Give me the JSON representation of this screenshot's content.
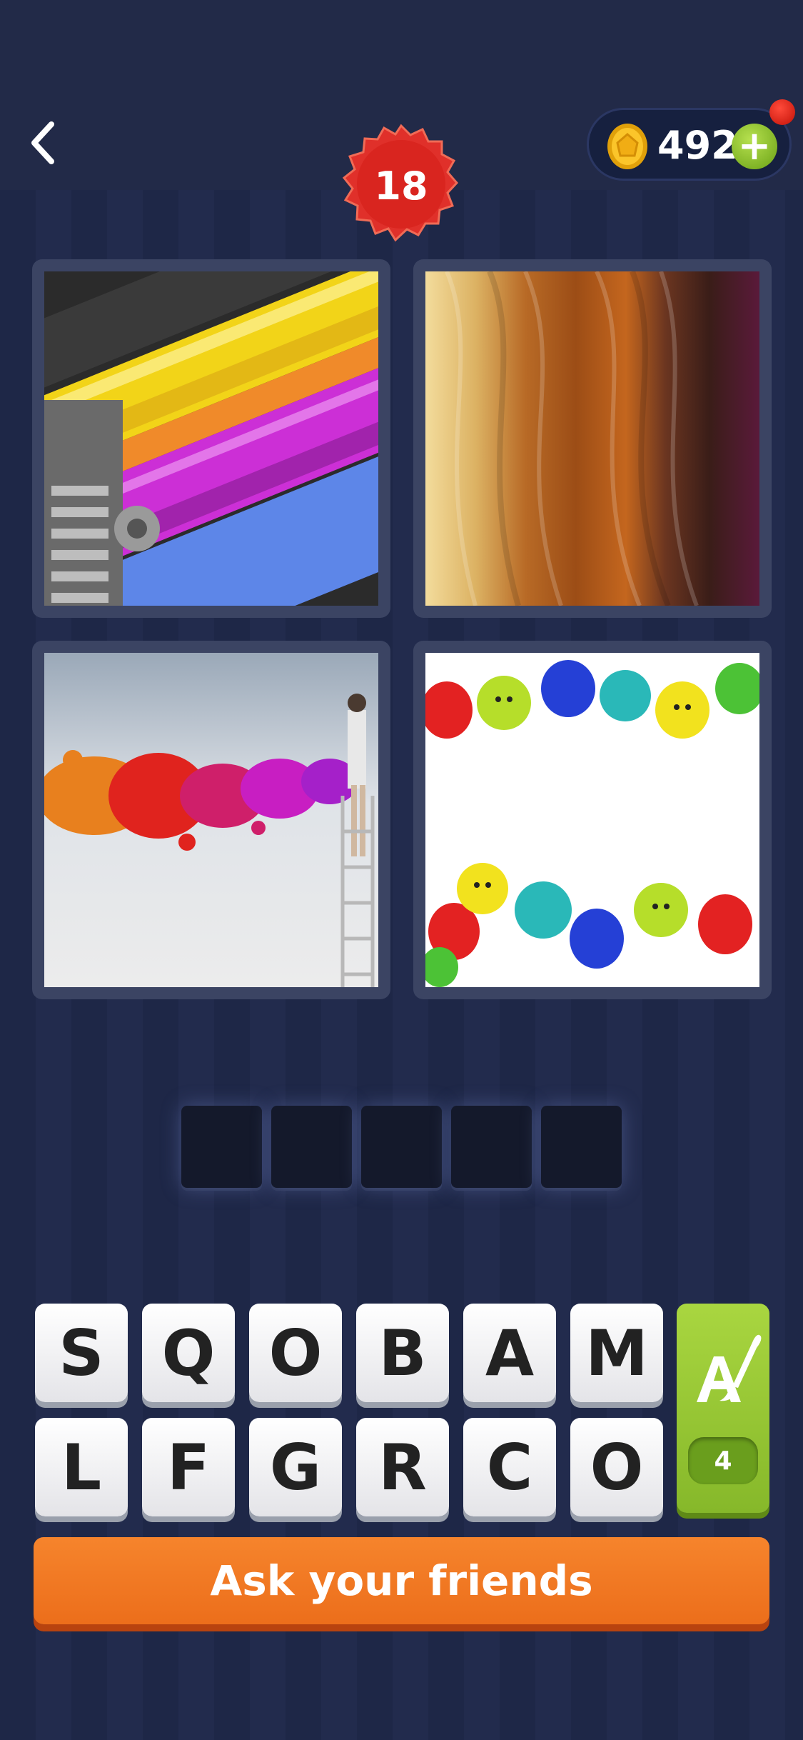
{
  "header": {
    "level": "18",
    "coins": "492",
    "back_icon": "chevron-left-icon",
    "plus_icon": "plus-icon"
  },
  "puzzle": {
    "images": [
      "printing-rollers-picture",
      "hair-colors-picture",
      "paint-splash-picture",
      "painted-hands-picture"
    ],
    "answer_slots": [
      "",
      "",
      "",
      "",
      ""
    ]
  },
  "keyboard": {
    "row1": [
      "S",
      "Q",
      "O",
      "B",
      "A",
      "M"
    ],
    "row2": [
      "L",
      "F",
      "G",
      "R",
      "C",
      "O"
    ],
    "hint_count": "4",
    "hint_icon": "brush-letter-a-icon"
  },
  "ask_button": "Ask your friends",
  "colors": {
    "accent_orange": "#ef7420",
    "hint_green": "#94c434",
    "badge_red": "#e3332b"
  }
}
